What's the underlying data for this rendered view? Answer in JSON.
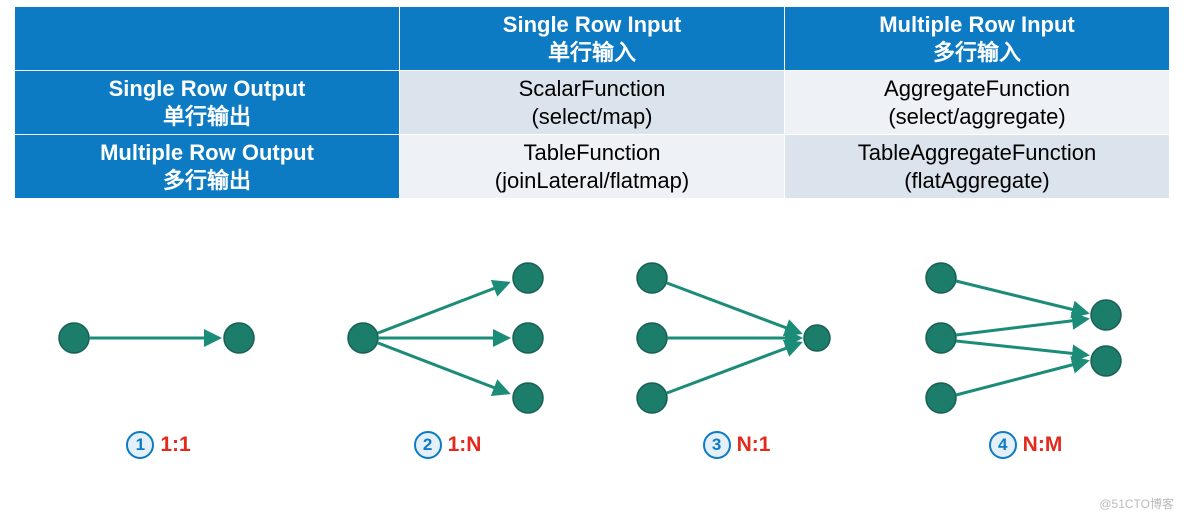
{
  "table": {
    "colHeaders": [
      {
        "en": "Single Row Input",
        "zh": "单行输入"
      },
      {
        "en": "Multiple Row Input",
        "zh": "多行输入"
      }
    ],
    "rowHeaders": [
      {
        "en": "Single Row Output",
        "zh": "单行输出"
      },
      {
        "en": "Multiple Row Output",
        "zh": "多行输出"
      }
    ],
    "cells": {
      "r0c0": {
        "name": "ScalarFunction",
        "op": "(select/map)"
      },
      "r0c1": {
        "name": "AggregateFunction",
        "op": "(select/aggregate)"
      },
      "r1c0": {
        "name": "TableFunction",
        "op": "(joinLateral/flatmap)"
      },
      "r1c1": {
        "name": "TableAggregateFunction",
        "op": "(flatAggregate)"
      }
    }
  },
  "diagrams": [
    {
      "num": "1",
      "ratio": "1:1"
    },
    {
      "num": "2",
      "ratio": "1:N"
    },
    {
      "num": "3",
      "ratio": "N:1"
    },
    {
      "num": "4",
      "ratio": "N:M"
    }
  ],
  "chart_data": [
    {
      "type": "diagram",
      "title": "1:1",
      "inputs": 1,
      "outputs": 1,
      "edges": [
        [
          0,
          0
        ]
      ]
    },
    {
      "type": "diagram",
      "title": "1:N",
      "inputs": 1,
      "outputs": 3,
      "edges": [
        [
          0,
          0
        ],
        [
          0,
          1
        ],
        [
          0,
          2
        ]
      ]
    },
    {
      "type": "diagram",
      "title": "N:1",
      "inputs": 3,
      "outputs": 1,
      "edges": [
        [
          0,
          0
        ],
        [
          1,
          0
        ],
        [
          2,
          0
        ]
      ]
    },
    {
      "type": "diagram",
      "title": "N:M",
      "inputs": 3,
      "outputs": 2,
      "edges": [
        [
          0,
          0
        ],
        [
          1,
          0
        ],
        [
          1,
          1
        ],
        [
          2,
          1
        ]
      ]
    }
  ],
  "watermark": "@51CTO博客"
}
